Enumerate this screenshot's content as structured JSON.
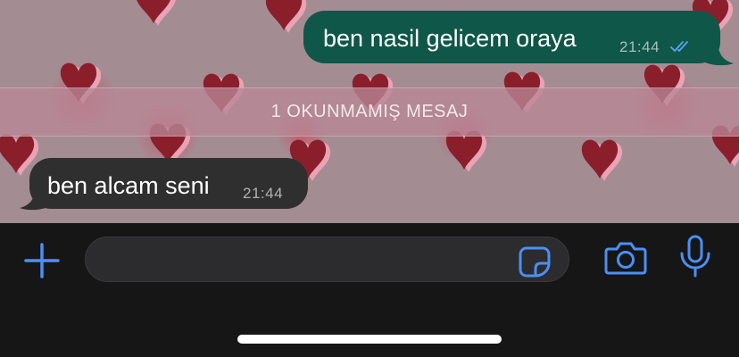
{
  "messages": [
    {
      "direction": "outgoing",
      "text": "ben nasil gelicem oraya",
      "time": "21:44",
      "status": "read"
    },
    {
      "direction": "incoming",
      "text": "ben alcam seni",
      "time": "21:44"
    }
  ],
  "unread_banner": {
    "label": "1 OKUNMAMIŞ MESAJ"
  },
  "composer": {
    "input_value": "",
    "icons": {
      "attach": "plus-icon",
      "sticker": "sticker-icon",
      "camera": "camera-icon",
      "voice": "microphone-icon"
    }
  },
  "colors": {
    "accent": "#4a8ff5",
    "outgoing_bubble": "#0f5748",
    "incoming_bubble": "#2f2f2f",
    "read_ticks": "#56a5f0",
    "wallpaper": "#a48c93",
    "heart": "#8a1f2b"
  }
}
